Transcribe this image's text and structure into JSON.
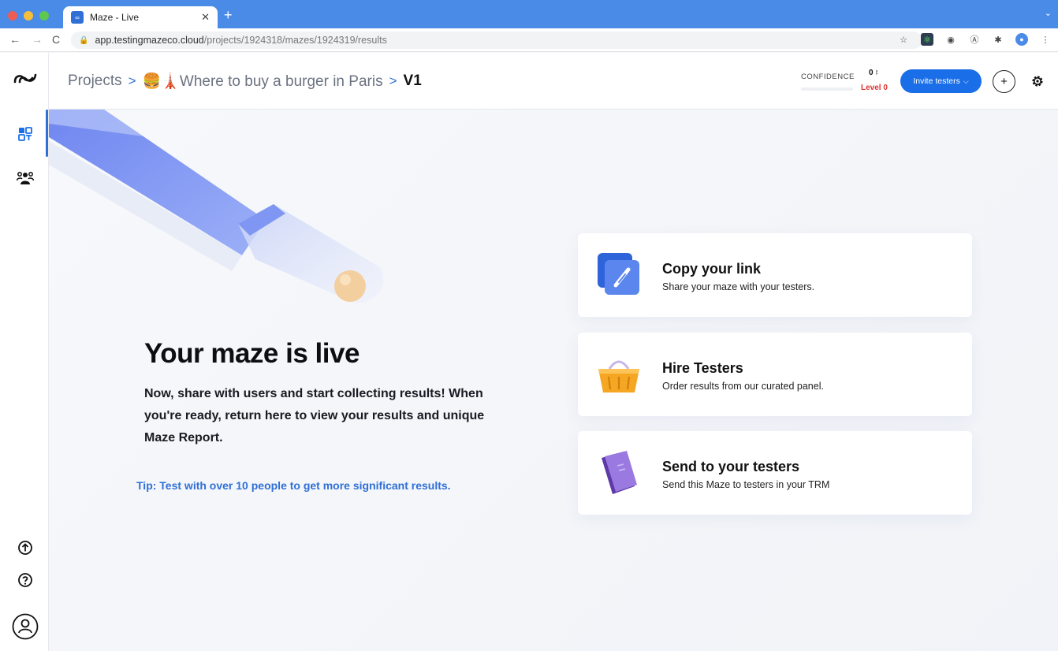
{
  "browser": {
    "tab_title": "Maze - Live",
    "url_host": "app.testingmazeco.cloud",
    "url_path": "/projects/1924318/mazes/1924319/results"
  },
  "topbar": {
    "breadcrumb": {
      "projects": "Projects",
      "project_name": "🍔🗼Where to buy a burger in Paris",
      "version": "V1"
    },
    "confidence_label": "CONFIDENCE",
    "confidence_count": "0",
    "confidence_level": "Level 0",
    "invite_label": "Invite testers"
  },
  "hero": {
    "title": "Your maze is live",
    "description": "Now, share with users and start collecting results! When you're ready, return here to view your results and unique Maze Report.",
    "tip": "Tip: Test with over 10 people to get more significant results."
  },
  "cards": [
    {
      "title": "Copy your link",
      "subtitle": "Share your maze with your testers.",
      "icon": "link-icon"
    },
    {
      "title": "Hire Testers",
      "subtitle": "Order results from our curated panel.",
      "icon": "basket-icon"
    },
    {
      "title": "Send to your testers",
      "subtitle": "Send this Maze to testers in your TRM",
      "icon": "notebook-icon"
    }
  ],
  "colors": {
    "accent": "#1a6ee8",
    "danger": "#d33333",
    "link": "#2f6fd6"
  }
}
